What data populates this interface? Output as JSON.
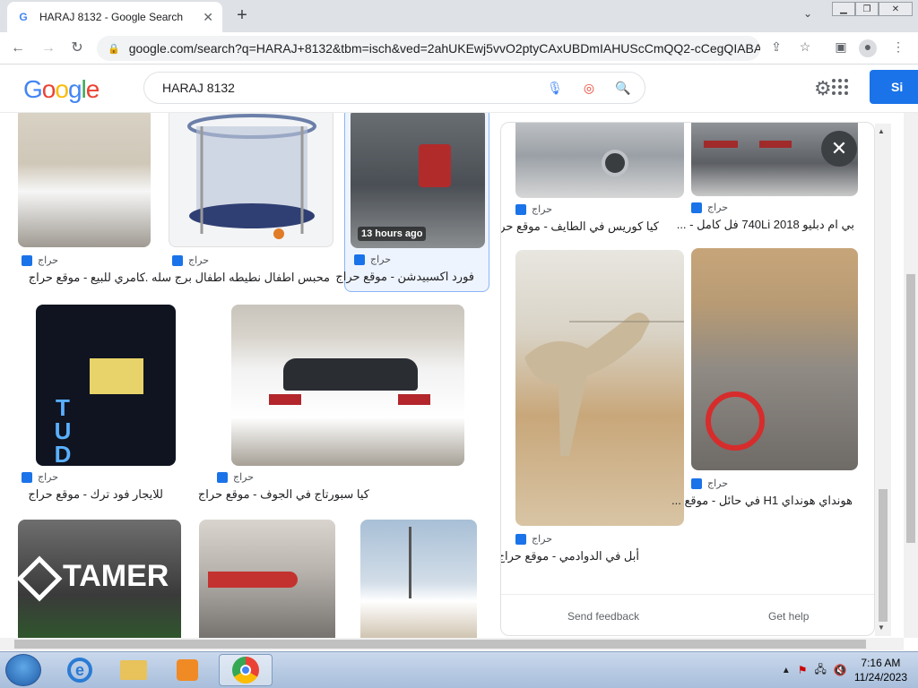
{
  "browser": {
    "tab_title": "HARAJ 8132 - Google Search",
    "url": "google.com/search?q=HARAJ+8132&tbm=isch&ved=2ahUKEwj5vvO2ptyCAxUBDmIAHUScCmQQ2-cCegQIABA...",
    "window_controls": [
      "minimize",
      "restore",
      "close"
    ]
  },
  "google": {
    "logo_letters": [
      {
        "ch": "G",
        "color": "#4285f4"
      },
      {
        "ch": "o",
        "color": "#ea4335"
      },
      {
        "ch": "o",
        "color": "#fbbc05"
      },
      {
        "ch": "g",
        "color": "#4285f4"
      },
      {
        "ch": "l",
        "color": "#34a853"
      },
      {
        "ch": "e",
        "color": "#ea4335"
      }
    ],
    "query": "HARAJ 8132",
    "signin_label": "Si"
  },
  "results": [
    {
      "source": "حراج",
      "caption": "كامري للبيع - موقع حراج",
      "img_color": "#cfc7b8",
      "img_desc": "car"
    },
    {
      "source": "حراج",
      "caption": "محبس اطفال نطيطه اطفال برج سله ...",
      "img_color": "#e9eaee",
      "img_desc": "trampoline"
    },
    {
      "source": "حراج",
      "caption": "فورد اكسبيدشن - موقع حراج",
      "img_color": "#4a4f55",
      "img_desc": "suv",
      "badge": "13 hours ago"
    },
    {
      "source": "حراج",
      "caption": "للايجار فود ترك - موقع حراج",
      "img_color": "#0f1420",
      "img_desc": "foodtruck"
    },
    {
      "source": "حراج",
      "caption": "كيا سبورتاج في الجوف - موقع حراج",
      "img_color": "#d8d4cc",
      "img_desc": "kia"
    },
    {
      "source": "",
      "caption": "",
      "img_color": "#3a3a3a",
      "img_desc": "tamer",
      "img_text": "TAMER"
    },
    {
      "source": "",
      "caption": "",
      "img_color": "#b9b4ae",
      "img_desc": "car-rear"
    },
    {
      "source": "",
      "caption": "",
      "img_color": "#a8bfd6",
      "img_desc": "car-desert"
    }
  ],
  "panel": {
    "items": [
      {
        "source": "حراج",
        "caption": "كيا كوريس في الطايف - موقع حراج",
        "img_color": "#9aa0a6"
      },
      {
        "source": "حراج",
        "caption": "بي ام دبليو 740Li 2018 فل كامل - ...",
        "img_color": "#7d8086"
      },
      {
        "source": "حراج",
        "caption": "أبل في الدوادمي - موقع حراج",
        "img_color": "#d8c4a4"
      },
      {
        "source": "حراج",
        "caption": "هونداي هونداي H1 في حائل - موقع ...",
        "img_color": "#8f8a84"
      }
    ],
    "send_feedback": "Send feedback",
    "get_help": "Get help"
  },
  "taskbar": {
    "time": "7:16 AM",
    "date": "11/24/2023"
  }
}
